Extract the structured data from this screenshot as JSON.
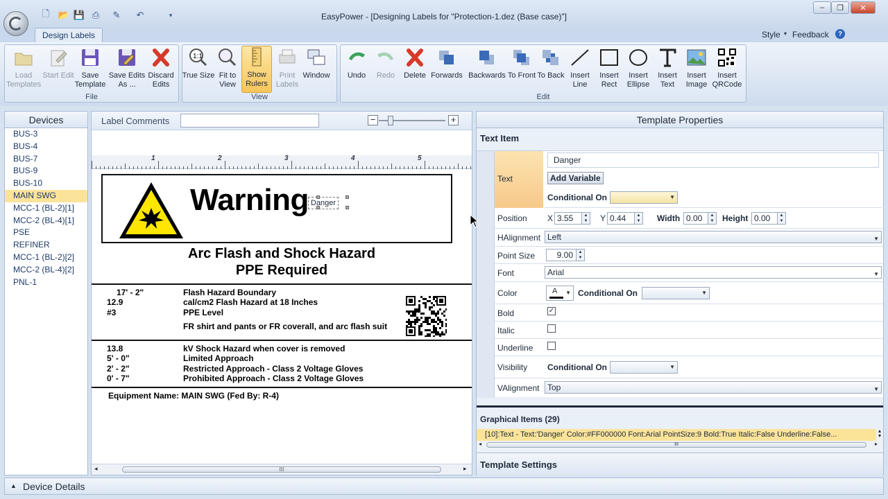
{
  "window": {
    "title": "EasyPower - [Designing Labels for \"Protection-1.dez  (Base case)\"]",
    "tab": "Design Labels",
    "style_menu": "Style",
    "feedback_menu": "Feedback"
  },
  "ribbon": {
    "file_group": "File",
    "view_group": "View",
    "edit_group": "Edit",
    "load_templates": "Load Templates",
    "start_edit": "Start Edit",
    "save_template": "Save Template",
    "save_edits_as": "Save Edits As ...",
    "discard_edits": "Discard Edits",
    "true_size": "True Size",
    "fit_to_view": "Fit to View",
    "show_rulers": "Show Rulers",
    "print_labels": "Print Labels",
    "window": "Window",
    "undo": "Undo",
    "redo": "Redo",
    "delete": "Delete",
    "forwards": "Forwards",
    "backwards": "Backwards",
    "to_front": "To Front",
    "to_back": "To Back",
    "insert_line": "Insert Line",
    "insert_rect": "Insert Rect",
    "insert_ellipse": "Insert Ellipse",
    "insert_text": "Insert Text",
    "insert_image": "Insert Image",
    "insert_qrcode": "Insert QRCode"
  },
  "devices": {
    "header": "Devices",
    "items": [
      "BUS-3",
      "BUS-4",
      "BUS-7",
      "BUS-9",
      "BUS-10",
      "MAIN SWG",
      "MCC-1 (BL-2)[1]",
      "MCC-2 (BL-4)[1]",
      "PSE",
      "REFINER",
      "MCC-1 (BL-2)[2]",
      "MCC-2 (BL-4)[2]",
      "PNL-1"
    ],
    "selected": "MAIN SWG"
  },
  "canvas": {
    "comments_label": "Label Comments",
    "comments_value": "",
    "ruler_numbers": [
      "1",
      "2",
      "3",
      "4",
      "5"
    ],
    "warning_title": "Warning",
    "danger_text": "Danger",
    "hazard_line1": "Arc Flash and Shock Hazard",
    "hazard_line2": "PPE Required",
    "flash_rows": [
      {
        "value": "17' - 2\"",
        "text": "Flash Hazard Boundary"
      },
      {
        "value": "12.9",
        "text": "cal/cm2 Flash Hazard at 18 Inches"
      },
      {
        "value": "#3",
        "text": "PPE Level"
      },
      {
        "value": "",
        "text": "FR shirt and pants or FR coverall, and arc flash suit"
      }
    ],
    "shock_rows": [
      {
        "value": "13.8",
        "text": "kV Shock Hazard when cover is removed"
      },
      {
        "value": "5' - 0\"",
        "text": "Limited Approach"
      },
      {
        "value": "2' - 2\"",
        "text": "Restricted Approach  - Class 2 Voltage Gloves"
      },
      {
        "value": "0' - 7\"",
        "text": "Prohibited Approach  - Class 2 Voltage Gloves"
      }
    ],
    "equipment": "Equipment Name: MAIN SWG (Fed By: R-4)",
    "scroll_grip": "III"
  },
  "props": {
    "header": "Template Properties",
    "section": "Text Item",
    "text_label": "Text",
    "text_value": "Danger",
    "add_variable": "Add Variable",
    "conditional_on": "Conditional On",
    "position_label": "Position",
    "x_label": "X",
    "x_value": "3.55",
    "y_label": "Y",
    "y_value": "0.44",
    "width_label": "Width",
    "width_value": "0.00",
    "height_label": "Height",
    "height_value": "0.00",
    "halignment_label": "HAlignment",
    "halignment_value": "Left",
    "pointsize_label": "Point Size",
    "pointsize_value": "9.00",
    "font_label": "Font",
    "font_value": "Arial",
    "color_label": "Color",
    "color_swatch": "#000000",
    "bold_label": "Bold",
    "bold_checked": "✓",
    "italic_label": "Italic",
    "underline_label": "Underline",
    "visibility_label": "Visibility",
    "valignment_label": "VAlignment",
    "valignment_value": "Top",
    "graphical_items": "Graphical Items (29)",
    "graphical_item_row": "[10]:Text - Text:'Danger' Color:#FF000000 Font:Arial PointSize:9 Bold:True Italic:False Underline:False...",
    "template_settings": "Template Settings"
  },
  "bottom": {
    "device_details": "Device Details"
  },
  "colors": {
    "accent_selected": "#fbe39a",
    "warning_yellow": "#ffe600",
    "undo_green": "#3aa25a",
    "delete_red": "#d63a2a"
  }
}
